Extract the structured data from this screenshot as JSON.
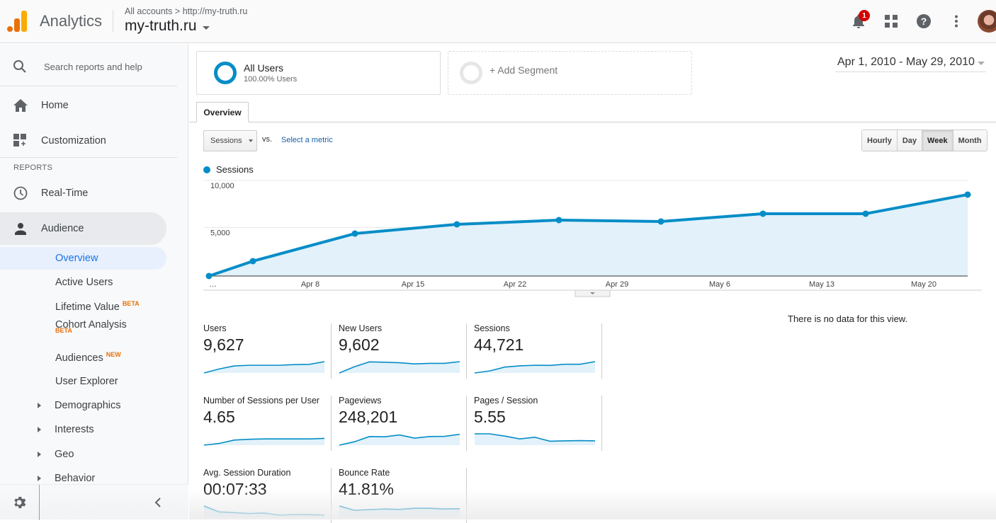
{
  "header": {
    "app_name": "Analytics",
    "breadcrumb": {
      "account": "All accounts",
      "separator": ">",
      "property_url": "http://my-truth.ru"
    },
    "property_name": "my-truth.ru",
    "notification_count": "1",
    "icons": [
      "notifications-bell-icon",
      "apps-grid-icon",
      "help-icon",
      "more-vert-icon",
      "user-avatar"
    ]
  },
  "sidebar": {
    "search_placeholder": "Search reports and help",
    "top_items": [
      {
        "label": "Home",
        "icon": "home-icon"
      },
      {
        "label": "Customization",
        "icon": "dashboard-add-icon"
      }
    ],
    "reports_label": "REPORTS",
    "report_items": [
      {
        "label": "Real-Time",
        "icon": "clock-icon"
      },
      {
        "label": "Audience",
        "icon": "person-icon",
        "active": true
      }
    ],
    "audience_subitems": [
      {
        "label": "Overview",
        "selected": true
      },
      {
        "label": "Active Users"
      },
      {
        "label": "Lifetime Value",
        "tag": "BETA"
      },
      {
        "label": "Cohort Analysis",
        "tag": "BETA"
      },
      {
        "label": "Audiences",
        "tag": "NEW"
      },
      {
        "label": "User Explorer"
      },
      {
        "label": "Demographics",
        "expandable": true
      },
      {
        "label": "Interests",
        "expandable": true
      },
      {
        "label": "Geo",
        "expandable": true
      },
      {
        "label": "Behavior",
        "expandable": true
      }
    ],
    "footer_icons": [
      "settings-gear-icon",
      "collapse-chevron-left-icon"
    ]
  },
  "segments": {
    "active": {
      "title": "All Users",
      "subtitle": "100.00% Users"
    },
    "add_label": "+ Add Segment"
  },
  "date_range": "Apr 1, 2010 - May 29, 2010",
  "tabs": [
    {
      "label": "Overview",
      "active": true
    }
  ],
  "controls": {
    "metric": "Sessions",
    "vs_label": "vs.",
    "select_metric": "Select a metric",
    "granularity": [
      {
        "label": "Hourly"
      },
      {
        "label": "Day"
      },
      {
        "label": "Week",
        "active": true
      },
      {
        "label": "Month"
      }
    ]
  },
  "chart_data": {
    "type": "area",
    "title": "",
    "legend": [
      {
        "name": "Sessions",
        "color": "#058dc7"
      }
    ],
    "legend_position": "top-left",
    "x_tick_labels": [
      "…",
      "Apr 8",
      "Apr 15",
      "Apr 22",
      "Apr 29",
      "May 6",
      "May 13",
      "May 20"
    ],
    "x": [
      "Apr 1",
      "Apr 4",
      "Apr 11",
      "Apr 18",
      "Apr 25",
      "May 2",
      "May 9",
      "May 16",
      "May 23"
    ],
    "series": [
      {
        "name": "Sessions",
        "values": [
          0,
          1580,
          4510,
          5490,
          5940,
          5790,
          6620,
          6620,
          8650
        ]
      }
    ],
    "y_ticks": [
      "10,000",
      "5,000"
    ],
    "ylim": [
      0,
      10000
    ],
    "grid": true,
    "xlabel": "",
    "ylabel": ""
  },
  "no_data_message": "There is no data for this view.",
  "metrics": [
    {
      "label": "Users",
      "value": "9,627",
      "spark": [
        0,
        0.35,
        0.62,
        0.68,
        0.68,
        0.68,
        0.74,
        0.76,
        1
      ]
    },
    {
      "label": "New Users",
      "value": "9,602",
      "spark": [
        0,
        0.55,
        0.98,
        0.95,
        0.9,
        0.8,
        0.85,
        0.85,
        1
      ]
    },
    {
      "label": "Sessions",
      "value": "44,721",
      "spark": [
        0,
        0.18,
        0.52,
        0.63,
        0.68,
        0.67,
        0.77,
        0.77,
        1
      ]
    },
    {
      "label": "Number of Sessions per User",
      "value": "4.65",
      "spark": [
        0,
        0.15,
        0.45,
        0.52,
        0.55,
        0.55,
        0.55,
        0.55,
        0.6
      ]
    },
    {
      "label": "Pageviews",
      "value": "248,201",
      "spark": [
        0,
        0.3,
        0.76,
        0.74,
        0.9,
        0.62,
        0.76,
        0.78,
        0.96
      ]
    },
    {
      "label": "Pages / Session",
      "value": "5.55",
      "spark": [
        1,
        1,
        0.8,
        0.55,
        0.7,
        0.35,
        0.38,
        0.4,
        0.38
      ]
    },
    {
      "label": "Avg. Session Duration",
      "value": "00:07:33",
      "spark": [
        1,
        0.48,
        0.42,
        0.34,
        0.38,
        0.2,
        0.24,
        0.24,
        0.2
      ]
    },
    {
      "label": "Bounce Rate",
      "value": "41.81%",
      "spark": [
        1,
        0.62,
        0.68,
        0.74,
        0.7,
        0.8,
        0.8,
        0.74,
        0.76
      ]
    }
  ],
  "colors": {
    "accent": "#058dc7",
    "area_fill": "#e2f1fa",
    "selected_nav": "#1a73e8",
    "tag": "#e8710a",
    "badge": "#d50000"
  }
}
